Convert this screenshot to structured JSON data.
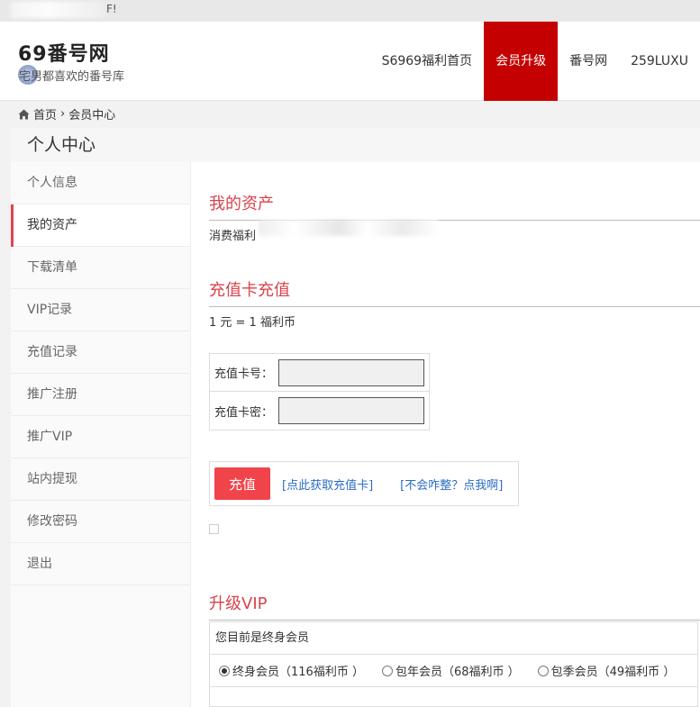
{
  "topbar": {
    "tail_text": "F!"
  },
  "header": {
    "logo": "69番号网",
    "slogan": "宅男都喜欢的番号库",
    "nav": [
      {
        "label": "S6969福利首页",
        "active": false
      },
      {
        "label": "会员升级",
        "active": true
      },
      {
        "label": "番号网",
        "active": false
      },
      {
        "label": "259LUXU",
        "active": false
      }
    ]
  },
  "breadcrumb": {
    "home": "首页",
    "separator": "›",
    "current": "会员中心"
  },
  "panel": {
    "title": "个人中心"
  },
  "sidebar": {
    "items": [
      {
        "label": "个人信息"
      },
      {
        "label": "我的资产"
      },
      {
        "label": "下载清单"
      },
      {
        "label": "VIP记录"
      },
      {
        "label": "充值记录"
      },
      {
        "label": "推广注册"
      },
      {
        "label": "推广VIP"
      },
      {
        "label": "站内提现"
      },
      {
        "label": "修改密码"
      },
      {
        "label": "退出"
      }
    ],
    "active_index": 1
  },
  "assets": {
    "title": "我的资产",
    "balance_label": "消费福利"
  },
  "recharge": {
    "title": "充值卡充值",
    "rate": "1 元 = 1 福利币",
    "card_no_label": "充值卡号：",
    "card_pwd_label": "充值卡密：",
    "card_no_value": "",
    "card_pwd_value": "",
    "submit_label": "充值",
    "get_card_link": "[点此获取充值卡]",
    "help_link": "[不会咋整？点我啊]"
  },
  "vip": {
    "title": "升级VIP",
    "current_status": "您目前是终身会员",
    "options": [
      {
        "label": "终身会员（116福利币 ）",
        "selected": true
      },
      {
        "label": "包年会员（68福利币 ）",
        "selected": false
      },
      {
        "label": "包季会员（49福利币 ）",
        "selected": false
      }
    ]
  },
  "colors": {
    "accent_red": "#c40000",
    "title_red": "#d9434b",
    "button_red": "#f0444a",
    "link_blue": "#2a6cc4"
  }
}
